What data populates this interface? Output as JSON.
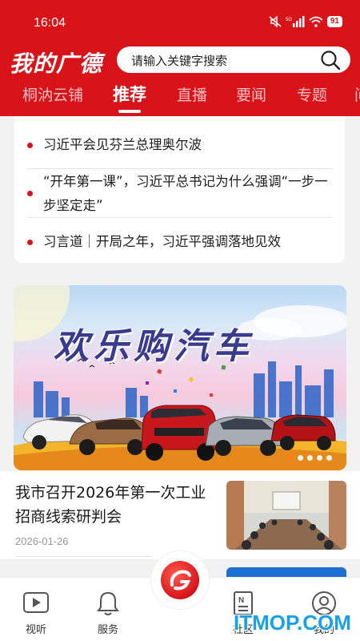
{
  "status_bar": {
    "time": "16:04",
    "battery": "91",
    "network": "5G"
  },
  "header": {
    "brand": "我的广德",
    "search_placeholder": "请输入关键字搜索",
    "tabs": [
      {
        "label": "桐汭云铺",
        "active": false
      },
      {
        "label": "推荐",
        "active": true
      },
      {
        "label": "直播",
        "active": false
      },
      {
        "label": "要闻",
        "active": false
      },
      {
        "label": "专题",
        "active": false
      },
      {
        "label": "问",
        "active": false
      }
    ]
  },
  "news_list": [
    {
      "title": "习近平会见芬兰总理奥尔波"
    },
    {
      "title": "“开年第一课”，习近平总书记为什么强调“一步一步坚定走”"
    },
    {
      "title": "习言道｜开局之年，习近平强调落地见效"
    }
  ],
  "banner": {
    "title": "欢乐购汽车",
    "slides_count": 5,
    "active_slide": 1
  },
  "article": {
    "title": "我市召开2026年第一次工业招商线索研判会",
    "date": "2026-01-26"
  },
  "bottom_nav": [
    {
      "label": "视听",
      "icon": "video-icon"
    },
    {
      "label": "服务",
      "icon": "bell-icon"
    },
    {
      "label": "",
      "icon": "home-logo-icon"
    },
    {
      "label": "社区",
      "icon": "newspaper-icon"
    },
    {
      "label": "我的",
      "icon": "user-icon"
    }
  ],
  "watermark": "ITMOP.COM",
  "colors": {
    "brand_red": "#d8141a",
    "watermark_blue": "#1aa0e6"
  }
}
